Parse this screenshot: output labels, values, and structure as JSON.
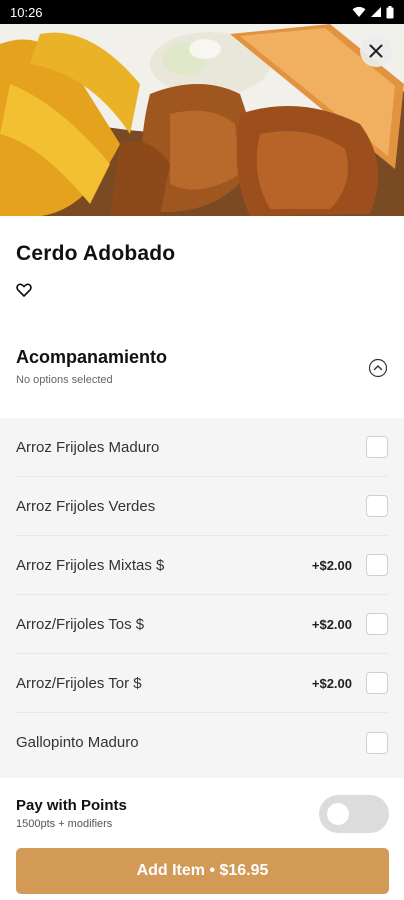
{
  "status_bar": {
    "time": "10:26",
    "icons": [
      "wifi-icon",
      "signal-icon",
      "battery-icon"
    ]
  },
  "hero": {
    "close_icon": "close-icon"
  },
  "item": {
    "title": "Cerdo Adobado",
    "favorite_icon": "heart-outline-icon"
  },
  "section": {
    "title": "Acompanamiento",
    "subtitle": "No options selected",
    "toggle_icon": "chevron-up-circle-icon"
  },
  "options": [
    {
      "label": "Arroz Frijoles Maduro",
      "price": ""
    },
    {
      "label": "Arroz Frijoles Verdes",
      "price": ""
    },
    {
      "label": "Arroz Frijoles Mixtas $",
      "price": "+$2.00"
    },
    {
      "label": "Arroz/Frijoles Tos $",
      "price": "+$2.00"
    },
    {
      "label": "Arroz/Frijoles Tor $",
      "price": "+$2.00"
    },
    {
      "label": "Gallopinto Maduro",
      "price": ""
    }
  ],
  "footer": {
    "pay_title": "Pay with Points",
    "pay_subtitle": "1500pts + modifiers",
    "pay_toggle_on": false,
    "add_button": "Add Item • $16.95"
  },
  "colors": {
    "accent": "#d39957",
    "option_bg": "#f5f5f5",
    "toggle_off": "#dcdcdc"
  }
}
